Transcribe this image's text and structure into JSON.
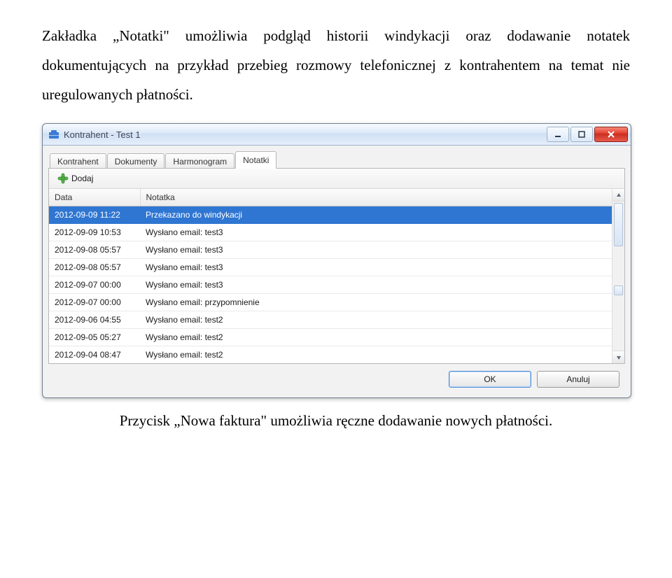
{
  "intro_paragraph": "Zakładka „Notatki\" umożliwia podgląd historii windykacji oraz dodawanie notatek dokumentujących na przykład przebieg rozmowy telefonicznej z kontrahentem na temat nie uregulowanych płatności.",
  "caption_text": "Przycisk „Nowa faktura\" umożliwia ręczne dodawanie nowych płatności.",
  "window": {
    "title": "Kontrahent - Test 1",
    "tabs": {
      "t0": "Kontrahent",
      "t1": "Dokumenty",
      "t2": "Harmonogram",
      "t3": "Notatki"
    },
    "toolbar": {
      "add_label": "Dodaj"
    },
    "grid": {
      "headers": {
        "date": "Data",
        "note": "Notatka"
      },
      "rows": [
        {
          "date": "2012-09-09 11:22",
          "note": "Przekazano do windykacji"
        },
        {
          "date": "2012-09-09 10:53",
          "note": "Wysłano email: test3"
        },
        {
          "date": "2012-09-08 05:57",
          "note": "Wysłano email: test3"
        },
        {
          "date": "2012-09-08 05:57",
          "note": "Wysłano email: test3"
        },
        {
          "date": "2012-09-07 00:00",
          "note": "Wysłano email: test3"
        },
        {
          "date": "2012-09-07 00:00",
          "note": "Wysłano email: przypomnienie"
        },
        {
          "date": "2012-09-06 04:55",
          "note": "Wysłano email: test2"
        },
        {
          "date": "2012-09-05 05:27",
          "note": "Wysłano email: test2"
        },
        {
          "date": "2012-09-04 08:47",
          "note": "Wysłano email: test2"
        }
      ]
    },
    "buttons": {
      "ok": "OK",
      "cancel": "Anuluj"
    }
  }
}
